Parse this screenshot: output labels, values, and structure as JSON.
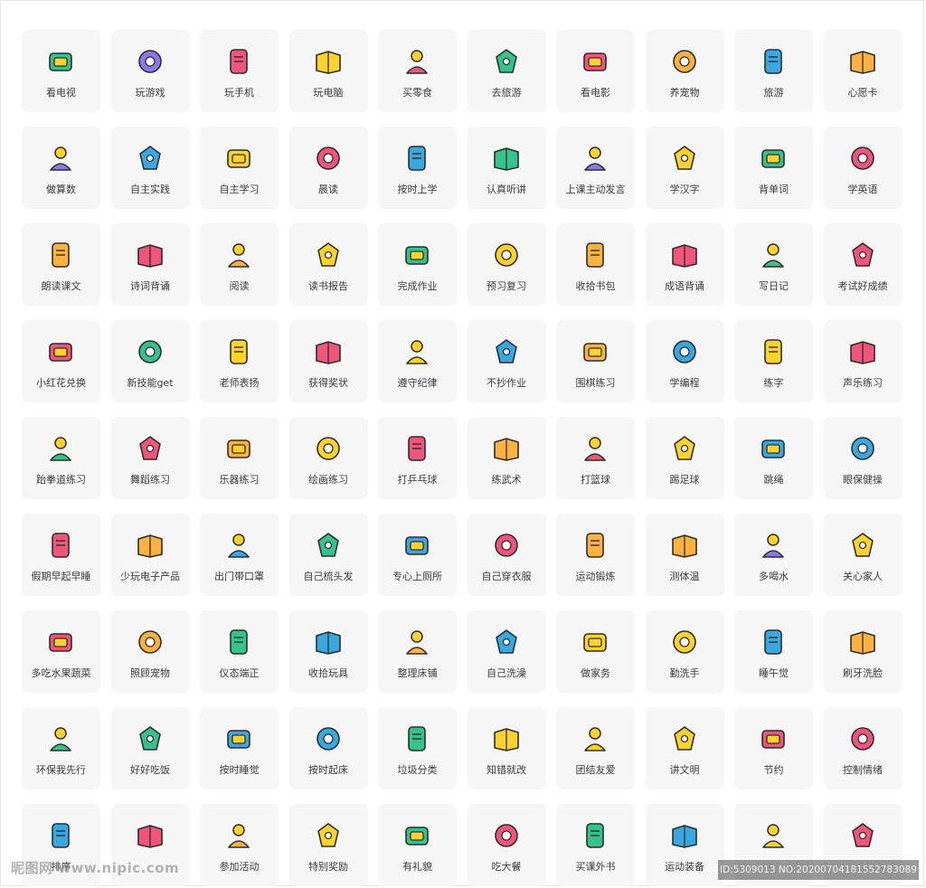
{
  "icons": [
    {
      "label": "看电视",
      "icon": "tv-icon",
      "color": "#35c28b"
    },
    {
      "label": "玩游戏",
      "icon": "gamepad-icon",
      "color": "#8c78e8"
    },
    {
      "label": "玩手机",
      "icon": "mobile-phone-icon",
      "color": "#f2557a"
    },
    {
      "label": "玩电脑",
      "icon": "computer-monitor-icon",
      "color": "#ffd22e"
    },
    {
      "label": "买零食",
      "icon": "candy-icon",
      "color": "#f2557a"
    },
    {
      "label": "去旅游",
      "icon": "suitcase-icon",
      "color": "#35c28b"
    },
    {
      "label": "看电影",
      "icon": "film-reel-icon",
      "color": "#f2557a"
    },
    {
      "label": "养宠物",
      "icon": "cat-icon",
      "color": "#ffb23f"
    },
    {
      "label": "旅游",
      "icon": "airplane-icon",
      "color": "#39a8e0"
    },
    {
      "label": "心愿卡",
      "icon": "wish-card-icon",
      "color": "#ffb23f"
    },
    {
      "label": "做算数",
      "icon": "ruler-triangle-icon",
      "color": "#8c78e8"
    },
    {
      "label": "自主实践",
      "icon": "scissors-icon",
      "color": "#39a8e0"
    },
    {
      "label": "自主学习",
      "icon": "pencil-ruler-icon",
      "color": "#ffd22e"
    },
    {
      "label": "晨读",
      "icon": "open-book-icon",
      "color": "#f2557a"
    },
    {
      "label": "按时上学",
      "icon": "school-building-icon",
      "color": "#39a8e0"
    },
    {
      "label": "认真听讲",
      "icon": "teacher-board-icon",
      "color": "#35c28b"
    },
    {
      "label": "上课主动发言",
      "icon": "raise-hand-icon",
      "color": "#8c78e8"
    },
    {
      "label": "学汉字",
      "icon": "chinese-character-icon",
      "color": "#ffd22e"
    },
    {
      "label": "背单词",
      "icon": "word-book-icon",
      "color": "#35c28b"
    },
    {
      "label": "学英语",
      "icon": "abc-board-icon",
      "color": "#f2557a"
    },
    {
      "label": "朗读课文",
      "icon": "reading-aloud-icon",
      "color": "#ffb23f"
    },
    {
      "label": "诗词背诵",
      "icon": "poetry-book-icon",
      "color": "#f2557a"
    },
    {
      "label": "阅读",
      "icon": "reading-person-icon",
      "color": "#ffb23f"
    },
    {
      "label": "读书报告",
      "icon": "scroll-report-icon",
      "color": "#ffd22e"
    },
    {
      "label": "完成作业",
      "icon": "homework-notebook-icon",
      "color": "#35c28b"
    },
    {
      "label": "预习复习",
      "icon": "review-book-icon",
      "color": "#ffd22e"
    },
    {
      "label": "收拾书包",
      "icon": "schoolbag-icon",
      "color": "#ffb23f"
    },
    {
      "label": "成语背诵",
      "icon": "idiom-scroll-icon",
      "color": "#f2557a"
    },
    {
      "label": "写日记",
      "icon": "diary-clipboard-icon",
      "color": "#35c28b"
    },
    {
      "label": "考试好成绩",
      "icon": "score-shield-icon",
      "color": "#f2557a"
    },
    {
      "label": "小红花兑换",
      "icon": "red-flower-icon",
      "color": "#f2557a"
    },
    {
      "label": "新技能get",
      "icon": "skill-book-icon",
      "color": "#35c28b"
    },
    {
      "label": "老师表扬",
      "icon": "thumbs-up-icon",
      "color": "#ffd22e"
    },
    {
      "label": "获得奖状",
      "icon": "certificate-icon",
      "color": "#f2557a"
    },
    {
      "label": "遵守纪律",
      "icon": "rules-book-icon",
      "color": "#ffd22e"
    },
    {
      "label": "不抄作业",
      "icon": "no-copy-pen-icon",
      "color": "#39a8e0"
    },
    {
      "label": "围棋练习",
      "icon": "go-board-icon",
      "color": "#ffb23f"
    },
    {
      "label": "学编程",
      "icon": "code-window-icon",
      "color": "#39a8e0"
    },
    {
      "label": "练字",
      "icon": "calligraphy-icon",
      "color": "#ffd22e"
    },
    {
      "label": "声乐练习",
      "icon": "lips-icon",
      "color": "#f2557a"
    },
    {
      "label": "跆拳道练习",
      "icon": "taekwondo-icon",
      "color": "#35c28b"
    },
    {
      "label": "舞蹈练习",
      "icon": "dancer-icon",
      "color": "#f2557a"
    },
    {
      "label": "乐器练习",
      "icon": "guitar-icon",
      "color": "#ffb23f"
    },
    {
      "label": "绘画练习",
      "icon": "paint-palette-icon",
      "color": "#ffd22e"
    },
    {
      "label": "打乒乓球",
      "icon": "ping-pong-icon",
      "color": "#f2557a"
    },
    {
      "label": "练武术",
      "icon": "martial-arts-icon",
      "color": "#ffb23f"
    },
    {
      "label": "打篮球",
      "icon": "basketball-icon",
      "color": "#f2557a"
    },
    {
      "label": "踢足球",
      "icon": "soccer-ball-icon",
      "color": "#ffd22e"
    },
    {
      "label": "跳绳",
      "icon": "jump-rope-icon",
      "color": "#39a8e0"
    },
    {
      "label": "眼保健操",
      "icon": "eye-icon",
      "color": "#39a8e0"
    },
    {
      "label": "假期早起早睡",
      "icon": "alarm-clock-icon",
      "color": "#f2557a"
    },
    {
      "label": "少玩电子产品",
      "icon": "no-phone-icon",
      "color": "#ffb23f"
    },
    {
      "label": "出门带口罩",
      "icon": "face-mask-icon",
      "color": "#39a8e0"
    },
    {
      "label": "自己梳头发",
      "icon": "comb-icon",
      "color": "#35c28b"
    },
    {
      "label": "专心上厕所",
      "icon": "toilet-icon",
      "color": "#39a8e0"
    },
    {
      "label": "自己穿衣服",
      "icon": "dress-icon",
      "color": "#f2557a"
    },
    {
      "label": "运动锻炼",
      "icon": "running-icon",
      "color": "#ffb23f"
    },
    {
      "label": "测体温",
      "icon": "thermometer-icon",
      "color": "#ffb23f"
    },
    {
      "label": "多喝水",
      "icon": "cup-icon",
      "color": "#8c78e8"
    },
    {
      "label": "关心家人",
      "icon": "heart-bubble-icon",
      "color": "#ffd22e"
    },
    {
      "label": "多吃水果蔬菜",
      "icon": "fruit-vegetable-icon",
      "color": "#f2557a"
    },
    {
      "label": "照顾宠物",
      "icon": "bear-face-icon",
      "color": "#ffb23f"
    },
    {
      "label": "仪态端正",
      "icon": "posture-icon",
      "color": "#35c28b"
    },
    {
      "label": "收拾玩具",
      "icon": "toy-box-icon",
      "color": "#39a8e0"
    },
    {
      "label": "整理床铺",
      "icon": "bed-icon",
      "color": "#ffb23f"
    },
    {
      "label": "自己洗澡",
      "icon": "bathtub-icon",
      "color": "#39a8e0"
    },
    {
      "label": "做家务",
      "icon": "broom-icon",
      "color": "#ffd22e"
    },
    {
      "label": "勤洗手",
      "icon": "hand-wash-icon",
      "color": "#ffd22e"
    },
    {
      "label": "睡午觉",
      "icon": "nap-bed-icon",
      "color": "#39a8e0"
    },
    {
      "label": "刷牙洗脸",
      "icon": "toothbrush-icon",
      "color": "#ffb23f"
    },
    {
      "label": "环保我先行",
      "icon": "trees-icon",
      "color": "#35c28b"
    },
    {
      "label": "好好吃饭",
      "icon": "rice-bowl-icon",
      "color": "#35c28b"
    },
    {
      "label": "按时睡觉",
      "icon": "moon-bed-icon",
      "color": "#39a8e0"
    },
    {
      "label": "按时起床",
      "icon": "sun-bed-icon",
      "color": "#39a8e0"
    },
    {
      "label": "垃圾分类",
      "icon": "recycle-bin-icon",
      "color": "#35c28b"
    },
    {
      "label": "知错就改",
      "icon": "check-circle-icon",
      "color": "#ffd22e"
    },
    {
      "label": "团结友爱",
      "icon": "friends-network-icon",
      "color": "#ffd22e"
    },
    {
      "label": "讲文明",
      "icon": "handshake-icon",
      "color": "#ffd22e"
    },
    {
      "label": "节约",
      "icon": "water-tap-icon",
      "color": "#f2557a"
    },
    {
      "label": "控制情绪",
      "icon": "fire-emotion-icon",
      "color": "#f2557a"
    },
    {
      "label": "排序",
      "icon": "traffic-light-icon",
      "color": "#39a8e0"
    },
    {
      "label": "",
      "icon": "red-flag-icon",
      "color": "#f2557a"
    },
    {
      "label": "参加活动",
      "icon": "balloons-icon",
      "color": "#ffb23f"
    },
    {
      "label": "特别奖励",
      "icon": "trophy-icon",
      "color": "#ffd22e"
    },
    {
      "label": "有礼貌",
      "icon": "polite-people-icon",
      "color": "#35c28b"
    },
    {
      "label": "吃大餐",
      "icon": "big-meal-icon",
      "color": "#f2557a"
    },
    {
      "label": "买课外书",
      "icon": "books-stack-icon",
      "color": "#35c28b"
    },
    {
      "label": "运动装备",
      "icon": "sneaker-icon",
      "color": "#39a8e0"
    },
    {
      "label": "",
      "icon": "shopping-cart-icon",
      "color": "#ffd22e"
    },
    {
      "label": "",
      "icon": "shopping-bag-icon",
      "color": "#f2557a"
    }
  ],
  "watermark": {
    "left_text": "昵图网 www.nipic.com",
    "right_text": "ID:5309013 NO:20200704181552783089"
  }
}
